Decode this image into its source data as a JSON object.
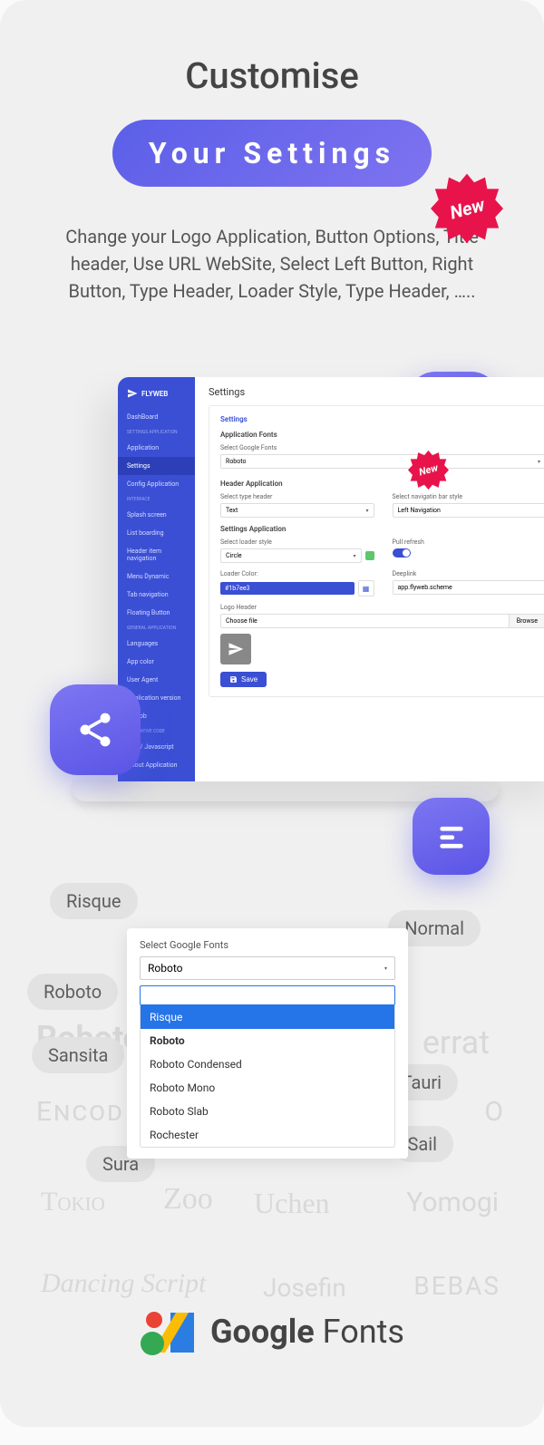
{
  "hero": {
    "title": "Customise",
    "subtitle": "Your Settings",
    "new_label": "New",
    "description": "Change your Logo Application, Button Options, Title header, Use URL WebSite, Select Left Button, Right Button, Type Header, Loader Style, Type Header, ….."
  },
  "laptop": {
    "brand": "FLYWEB",
    "sidebar": {
      "items": [
        {
          "label": "DashBoard"
        },
        {
          "label": "SETTINGS APPLICATION",
          "section": true
        },
        {
          "label": "Application"
        },
        {
          "label": "Settings",
          "active": true
        },
        {
          "label": "Config Application"
        },
        {
          "label": "INTERFACE",
          "section": true
        },
        {
          "label": "Splash screen"
        },
        {
          "label": "List boarding"
        },
        {
          "label": "Header item navigation"
        },
        {
          "label": "Menu Dynamic"
        },
        {
          "label": "Tab navigation"
        },
        {
          "label": "Floating Button"
        },
        {
          "label": "GENERAL APPLICATION",
          "section": true
        },
        {
          "label": "Languages"
        },
        {
          "label": "App color"
        },
        {
          "label": "User Agent"
        },
        {
          "label": "Application version"
        },
        {
          "label": "adMob"
        },
        {
          "label": "APP NATIVE CODE",
          "section": true
        },
        {
          "label": "CSS / Javascript"
        },
        {
          "label": "About Application"
        }
      ]
    },
    "page_title": "Settings",
    "card": {
      "head": "Settings",
      "app_fonts_section": "Application Fonts",
      "google_fonts_label": "Select Google Fonts",
      "google_fonts_value": "Roboto",
      "header_section": "Header Application",
      "type_header_label": "Select type header",
      "type_header_value": "Text",
      "nav_bar_label": "Select navigatin bar style",
      "nav_bar_value": "Left Navigation",
      "settings_section": "Settings Application",
      "loader_style_label": "Select loader style",
      "loader_style_value": "Circle",
      "pull_refresh_label": "Pull refresh",
      "loader_color_label": "Loader Color:",
      "loader_color_value": "#1b7ee3",
      "deeplink_label": "Deeplink",
      "deeplink_value": "app.flyweb.scheme",
      "logo_header_label": "Logo Header",
      "choose_file": "Choose file",
      "browse": "Browse",
      "save": "Save",
      "new_label": "New"
    }
  },
  "font_panel": {
    "label": "Select Google Fonts",
    "selected": "Roboto",
    "search": "",
    "options": [
      {
        "label": "Risque",
        "highlight": true
      },
      {
        "label": "Roboto",
        "bold": true
      },
      {
        "label": "Roboto Condensed"
      },
      {
        "label": "Roboto Mono"
      },
      {
        "label": "Roboto Slab"
      },
      {
        "label": "Rochester"
      }
    ]
  },
  "pills": {
    "risque": "Risque",
    "normal": "Normal",
    "roboto": "Roboto",
    "sansita": "Sansita",
    "tauri": "Tauri",
    "sail": "Sail",
    "sura": "Sura"
  },
  "bg_fonts": {
    "f1": "Roboto",
    "f2": "errat",
    "f3": "Encod",
    "f4": "O",
    "f5": "Tokio",
    "f6": "Zoo",
    "f7": "Uchen",
    "f8": "Yomogi",
    "f9": "Dancing Script",
    "f10": "Josefin",
    "f11": "BEBAS"
  },
  "google_fonts": {
    "google": "Google",
    "fonts": " Fonts"
  }
}
